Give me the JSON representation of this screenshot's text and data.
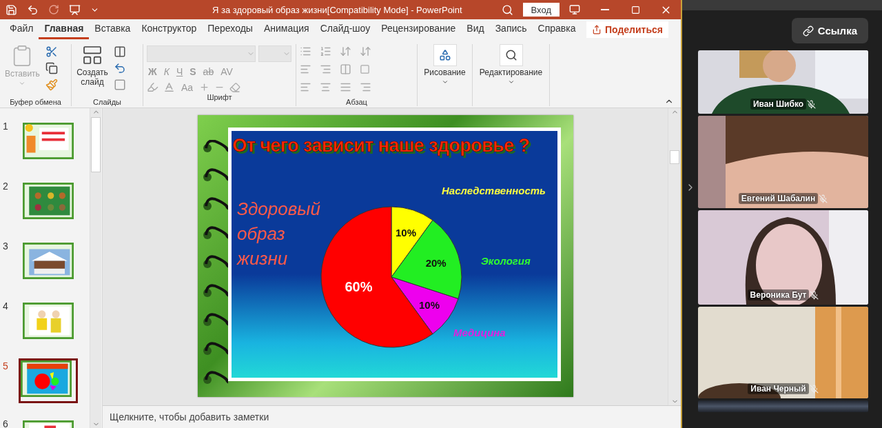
{
  "window": {
    "title": "Я за здоровый образ жизни[Compatibility Mode]  -  PowerPoint",
    "sign_in": "Вход"
  },
  "ribbon_tabs": [
    {
      "label": "Файл",
      "selected": false
    },
    {
      "label": "Главная",
      "selected": true
    },
    {
      "label": "Вставка",
      "selected": false
    },
    {
      "label": "Конструктор",
      "selected": false
    },
    {
      "label": "Переходы",
      "selected": false
    },
    {
      "label": "Анимация",
      "selected": false
    },
    {
      "label": "Слайд-шоу",
      "selected": false
    },
    {
      "label": "Рецензирование",
      "selected": false
    },
    {
      "label": "Вид",
      "selected": false
    },
    {
      "label": "Запись",
      "selected": false
    },
    {
      "label": "Справка",
      "selected": false
    }
  ],
  "share_button": {
    "label": "Поделиться"
  },
  "ribbon": {
    "clipboard": {
      "paste": "Вставить",
      "label": "Буфер обмена"
    },
    "slides": {
      "new_slide": "Создать слайд",
      "label": "Слайды"
    },
    "font": {
      "label": "Шрифт",
      "format_buttons": [
        "Ж",
        "К",
        "Ч",
        "S",
        "ab",
        "AV"
      ],
      "case_button": "Aa"
    },
    "paragraph": {
      "label": "Абзац"
    },
    "drawing": {
      "label": "Рисование"
    },
    "editing": {
      "label": "Редактирование"
    }
  },
  "slide_thumbnails": [
    {
      "number": "1",
      "selected": false
    },
    {
      "number": "2",
      "selected": false
    },
    {
      "number": "3",
      "selected": false
    },
    {
      "number": "4",
      "selected": false
    },
    {
      "number": "5",
      "selected": true
    },
    {
      "number": "6",
      "selected": false
    }
  ],
  "slide": {
    "title": "От чего зависит наше здоровье ?",
    "chart_data": {
      "type": "pie",
      "categories": [
        "Наследственность",
        "Экология",
        "Медицина",
        "Здоровый образ жизни"
      ],
      "values": [
        10,
        20,
        10,
        60
      ],
      "data_labels": true,
      "value_labels": [
        "10%",
        "20%",
        "10%",
        "60%"
      ]
    }
  },
  "notes": {
    "placeholder": "Щелкните, чтобы добавить заметки"
  },
  "call_panel": {
    "link_button": "Ссылка",
    "participants": [
      {
        "name": "Иван Шибко",
        "muted": true
      },
      {
        "name": "Евгений Шабалин",
        "muted": true
      },
      {
        "name": "Вероника Бут",
        "muted": true
      },
      {
        "name": "Иван Черный",
        "muted": true
      }
    ]
  }
}
